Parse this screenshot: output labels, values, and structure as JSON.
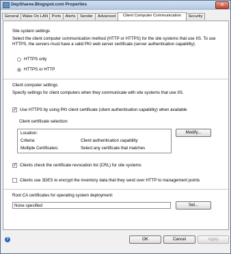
{
  "window": {
    "title": "DepSharee.Blogspot.com Properties",
    "close_glyph": "✕"
  },
  "tabs": [
    {
      "label": "General"
    },
    {
      "label": "Wake On LAN"
    },
    {
      "label": "Ports"
    },
    {
      "label": "Alerts"
    },
    {
      "label": "Sender"
    },
    {
      "label": "Advanced"
    },
    {
      "label": "Client Computer Communication"
    },
    {
      "label": "Security"
    }
  ],
  "site_system": {
    "heading": "Site system settings",
    "description": "Select the client computer communication method (HTTP or HTTPS) for the site systems that use IIS. To use HTTPS, the servers must have a valid PKI web server certificate (server authentication capability).",
    "https_only_label": "HTTPS only",
    "https_or_http_label": "HTTPS or HTTP",
    "selected": "HTTPS or HTTP"
  },
  "client": {
    "heading": "Client computer settings",
    "description": "Specify settings for client computers when they communicate with site systems that use IIS.",
    "use_pki_label": "Use HTTPS by using PKI client certificate (client authentication capability) when available",
    "use_pki_checked": true,
    "cert_selection_label": "Client certificate selection:",
    "cert_rows": [
      {
        "key": "Location:",
        "value": ""
      },
      {
        "key": "Criteria:",
        "value": "Client authentication capability"
      },
      {
        "key": "Multiple Certificates:",
        "value": "Select any certificate that matches"
      }
    ],
    "modify_label": "Modify...",
    "crl_label": "Clients check the certificate revocation list (CRL) for site systems",
    "crl_checked": true,
    "des_label": "Clients use 3DES to encrypt the inventory data that they send over HTTP to management points",
    "des_checked": false,
    "check_glyph": "✓"
  },
  "root_ca": {
    "label": "Root CA certificates for operating system deployment:",
    "value": "None specified",
    "set_label": "Set..."
  },
  "footer": {
    "help_glyph": "?",
    "ok_label": "OK",
    "cancel_label": "Cancel",
    "apply_label": "Apply"
  }
}
